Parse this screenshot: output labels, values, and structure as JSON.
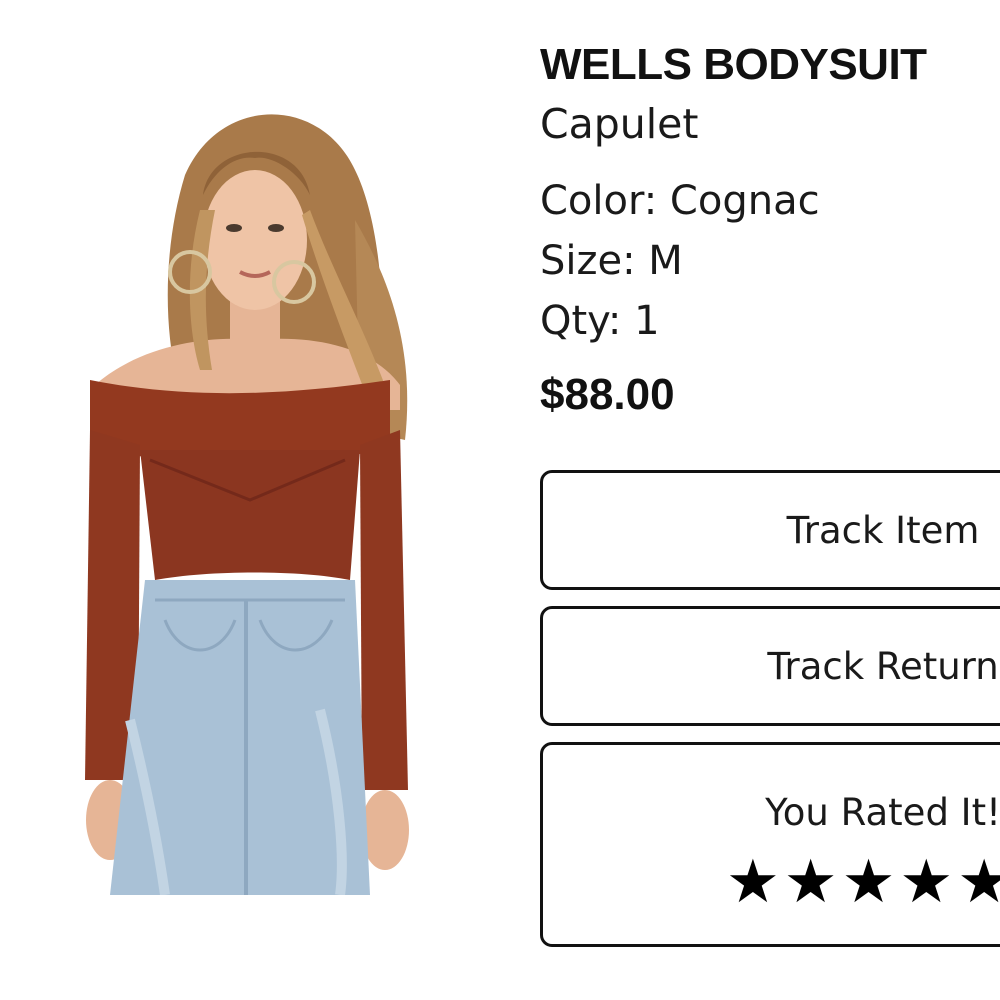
{
  "product": {
    "image_alt": "Model wearing rust off-shoulder ribbed bodysuit with light wash jeans",
    "name": "WELLS BODYSUIT",
    "brand": "Capulet",
    "color": "Color: Cognac",
    "size": "Size: M",
    "qty": "Qty: 1",
    "price": "$88.00"
  },
  "actions": {
    "track_item_label": "Track Item",
    "track_return_label": "Track Return",
    "rating_label": "You Rated It!"
  },
  "rating": {
    "stars_shown": 5,
    "star_icon": "star-icon",
    "star_glyph": "★"
  },
  "colors": {
    "bodysuit": "#93391f",
    "denim": "#a9c1d6",
    "border": "#111111"
  }
}
